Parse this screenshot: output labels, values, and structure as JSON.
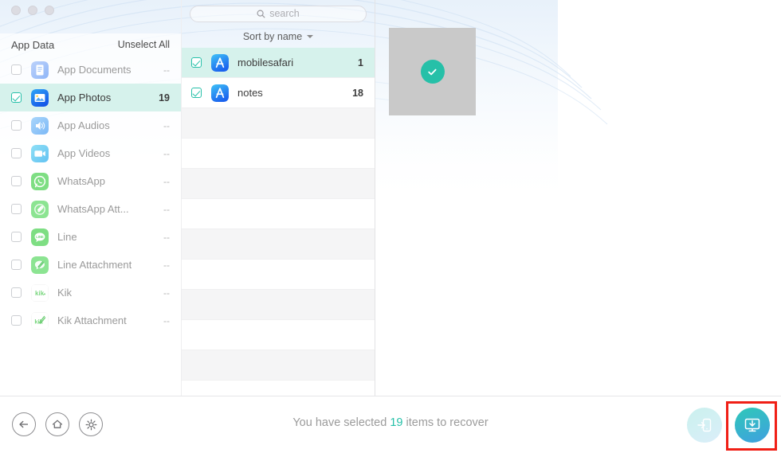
{
  "window": {
    "traffic_lights": [
      "close",
      "minimize",
      "zoom"
    ]
  },
  "sidebar": {
    "title": "App Data",
    "unselect_all": "Unselect All",
    "items": [
      {
        "label": "App Documents",
        "count": "--",
        "icon": "app-documents-icon",
        "selected": false
      },
      {
        "label": "App Photos",
        "count": "19",
        "icon": "app-photos-icon",
        "selected": true
      },
      {
        "label": "App Audios",
        "count": "--",
        "icon": "app-audios-icon",
        "selected": false
      },
      {
        "label": "App Videos",
        "count": "--",
        "icon": "app-videos-icon",
        "selected": false
      },
      {
        "label": "WhatsApp",
        "count": "--",
        "icon": "whatsapp-icon",
        "selected": false
      },
      {
        "label": "WhatsApp Att...",
        "count": "--",
        "icon": "whatsapp-attachment-icon",
        "selected": false
      },
      {
        "label": "Line",
        "count": "--",
        "icon": "line-icon",
        "selected": false
      },
      {
        "label": "Line Attachment",
        "count": "--",
        "icon": "line-attachment-icon",
        "selected": false
      },
      {
        "label": "Kik",
        "count": "--",
        "icon": "kik-icon",
        "selected": false
      },
      {
        "label": "Kik Attachment",
        "count": "--",
        "icon": "kik-attachment-icon",
        "selected": false
      }
    ]
  },
  "middle": {
    "search": {
      "placeholder": "search",
      "value": ""
    },
    "sort": {
      "label": "Sort by name"
    },
    "rows": [
      {
        "label": "mobilesafari",
        "count": "1",
        "icon": "app-store-icon",
        "selected": true,
        "checked": true
      },
      {
        "label": "notes",
        "count": "18",
        "icon": "app-store-icon",
        "selected": false,
        "checked": true
      }
    ],
    "empty_row_count": 10
  },
  "preview": {
    "thumbnail": {
      "name": "photo-thumbnail",
      "selected_badge": "check-icon"
    }
  },
  "bottom": {
    "nav": [
      {
        "name": "back-button",
        "icon": "arrow-left-icon"
      },
      {
        "name": "home-button",
        "icon": "home-icon"
      },
      {
        "name": "settings-button",
        "icon": "gear-icon"
      }
    ],
    "status_prefix": "You have selected ",
    "status_count": "19",
    "status_suffix": " items to recover",
    "actions": [
      {
        "name": "recover-to-device-button",
        "icon": "export-to-device-icon",
        "highlighted": false
      },
      {
        "name": "recover-to-computer-button",
        "icon": "download-to-computer-icon",
        "highlighted": true
      }
    ]
  },
  "annotation": {
    "name": "red-highlight-box",
    "color": "#f01f16"
  },
  "colors": {
    "accent_teal": "#26c0a8",
    "selection_bg": "#d6f2ec",
    "annotation_red": "#f01f16",
    "muted_text": "#9a9a9a"
  }
}
